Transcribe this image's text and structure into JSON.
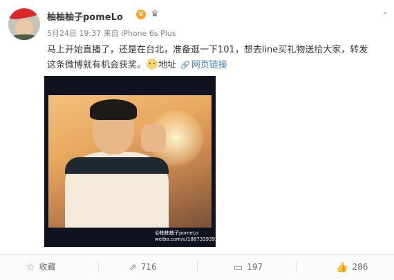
{
  "post": {
    "author": "柚柚柚子pomeLo",
    "verified_badge": "V",
    "date": "5月24日 19:37",
    "source_prefix": "来自",
    "source": "iPhone 6s Plus",
    "text_line1": "马上开始直播了，还是在台北，准备逛一下101，想去line买礼物送给大家，转发",
    "text_line2": "这条微博就有机会获奖。",
    "location_label": "地址",
    "link_label": "网页链接",
    "image_caption_line1": "@柚柚柚子pomeLo",
    "image_caption_line2": "weibo.com/u/1887339392"
  },
  "actions": {
    "favorite": "收藏",
    "repost_count": "716",
    "comment_count": "197",
    "like_count": "286"
  },
  "icons": {
    "badge": "verified-v-icon",
    "member": "crown-icon",
    "menu": "chevron-down-icon",
    "link": "link-icon",
    "favorite": "star-icon",
    "repost": "repost-icon",
    "comment": "comment-icon",
    "like": "thumbs-up-icon"
  },
  "colors": {
    "link": "#3e7cc2",
    "badge": "#f5a623"
  }
}
